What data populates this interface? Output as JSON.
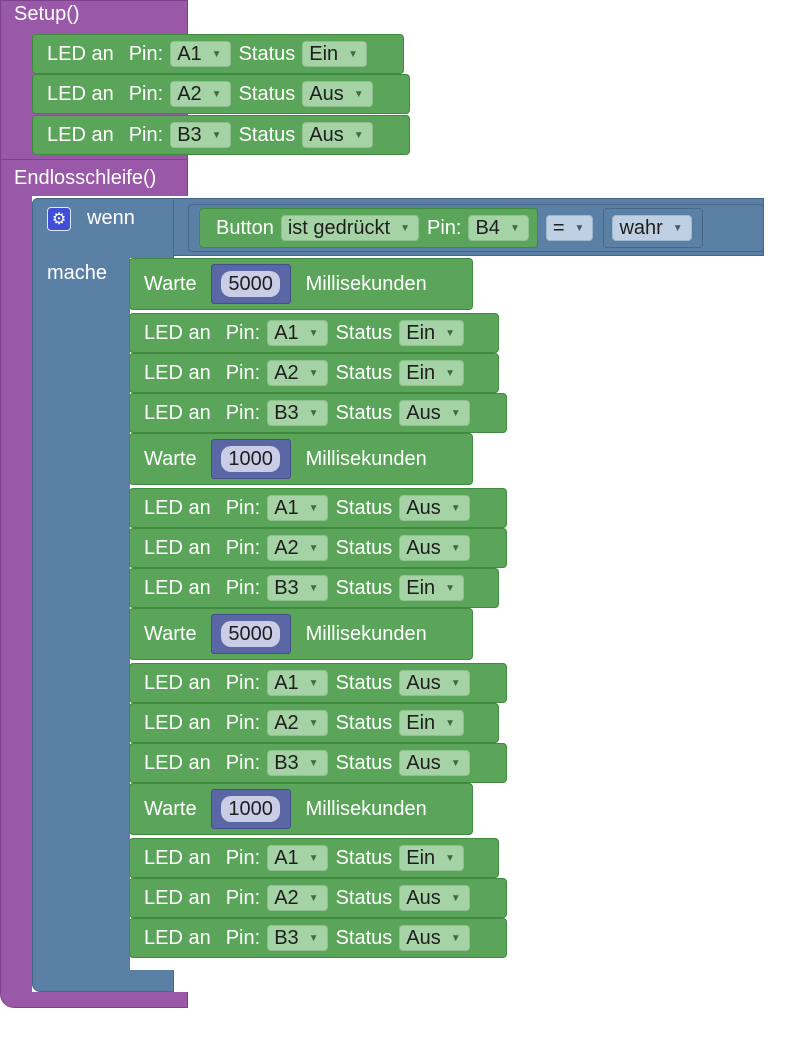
{
  "setup": {
    "label": "Setup()",
    "blocks": [
      {
        "led": "LED an",
        "pin": "Pin:",
        "pin_value": "A1",
        "status": "Status",
        "state": "Ein"
      },
      {
        "led": "LED an",
        "pin": "Pin:",
        "pin_value": "A2",
        "status": "Status",
        "state": "Aus"
      },
      {
        "led": "LED an",
        "pin": "Pin:",
        "pin_value": "B3",
        "status": "Status",
        "state": "Aus"
      }
    ]
  },
  "loop": {
    "label": "Endlosschleife()",
    "if_block": {
      "wenn": "wenn",
      "mache": "mache",
      "condition": {
        "button": "Button",
        "pressed": "ist gedrückt",
        "pin": "Pin:",
        "pin_value": "B4",
        "operator": "=",
        "value": "wahr"
      }
    },
    "statements": [
      {
        "kind": "wait",
        "warte": "Warte",
        "ms": "5000",
        "unit": "Millisekunden"
      },
      {
        "kind": "led",
        "led": "LED an",
        "pin": "Pin:",
        "pin_value": "A1",
        "status": "Status",
        "state": "Ein"
      },
      {
        "kind": "led",
        "led": "LED an",
        "pin": "Pin:",
        "pin_value": "A2",
        "status": "Status",
        "state": "Ein"
      },
      {
        "kind": "led",
        "led": "LED an",
        "pin": "Pin:",
        "pin_value": "B3",
        "status": "Status",
        "state": "Aus"
      },
      {
        "kind": "wait",
        "warte": "Warte",
        "ms": "1000",
        "unit": "Millisekunden"
      },
      {
        "kind": "led",
        "led": "LED an",
        "pin": "Pin:",
        "pin_value": "A1",
        "status": "Status",
        "state": "Aus"
      },
      {
        "kind": "led",
        "led": "LED an",
        "pin": "Pin:",
        "pin_value": "A2",
        "status": "Status",
        "state": "Aus"
      },
      {
        "kind": "led",
        "led": "LED an",
        "pin": "Pin:",
        "pin_value": "B3",
        "status": "Status",
        "state": "Ein"
      },
      {
        "kind": "wait",
        "warte": "Warte",
        "ms": "5000",
        "unit": "Millisekunden"
      },
      {
        "kind": "led",
        "led": "LED an",
        "pin": "Pin:",
        "pin_value": "A1",
        "status": "Status",
        "state": "Aus"
      },
      {
        "kind": "led",
        "led": "LED an",
        "pin": "Pin:",
        "pin_value": "A2",
        "status": "Status",
        "state": "Ein"
      },
      {
        "kind": "led",
        "led": "LED an",
        "pin": "Pin:",
        "pin_value": "B3",
        "status": "Status",
        "state": "Aus"
      },
      {
        "kind": "wait",
        "warte": "Warte",
        "ms": "1000",
        "unit": "Millisekunden"
      },
      {
        "kind": "led",
        "led": "LED an",
        "pin": "Pin:",
        "pin_value": "A1",
        "status": "Status",
        "state": "Ein"
      },
      {
        "kind": "led",
        "led": "LED an",
        "pin": "Pin:",
        "pin_value": "A2",
        "status": "Status",
        "state": "Aus"
      },
      {
        "kind": "led",
        "led": "LED an",
        "pin": "Pin:",
        "pin_value": "B3",
        "status": "Status",
        "state": "Aus"
      }
    ]
  },
  "colors": {
    "program_block": "#9a59a8",
    "logic_block": "#5b80a5",
    "io_block": "#5ba55b",
    "number_block": "#5b67a5"
  },
  "icons": {
    "dropdown": "dropdown-arrow-icon",
    "mutator": "gear-icon"
  }
}
